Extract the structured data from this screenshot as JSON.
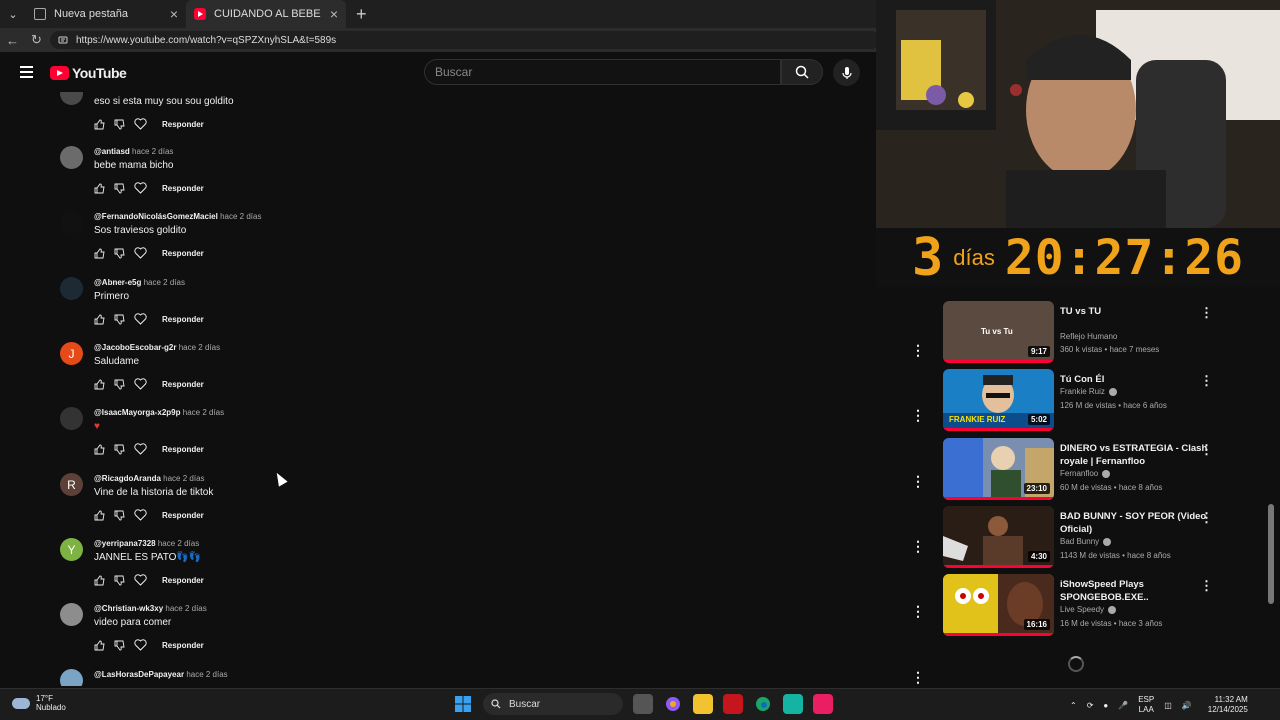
{
  "browser": {
    "tabs": [
      {
        "label": "Nueva pestaña"
      },
      {
        "label": "CUIDANDO AL BEBE DEL DIABLO |"
      }
    ],
    "url": "https://www.youtube.com/watch?v=qSPZXnyhSLA&t=589s"
  },
  "header": {
    "logo_text": "YouTube",
    "search_placeholder": "Buscar"
  },
  "comments": [
    {
      "author": "",
      "time": "",
      "text": "eso si esta muy sou sou goldito",
      "reply": "Responder",
      "avatar_color": "#4a4a4a",
      "avatar_letter": "",
      "show_more": false
    },
    {
      "author": "@antiasd",
      "time": "hace 2 días",
      "text": "bebe mama bicho",
      "reply": "Responder",
      "avatar_color": "#6b6b6b",
      "avatar_letter": "",
      "show_more": false
    },
    {
      "author": "@FernandoNicolásGomezMaciel",
      "time": "hace 2 días",
      "text": "Sos traviesos goldito",
      "reply": "Responder",
      "avatar_color": "#111111",
      "avatar_letter": "",
      "show_more": false
    },
    {
      "author": "@Abner-e5g",
      "time": "hace 2 días",
      "text": "Primero",
      "reply": "Responder",
      "avatar_color": "#1e2a33",
      "avatar_letter": "",
      "show_more": false
    },
    {
      "author": "@JacoboEscobar-g2r",
      "time": "hace 2 días",
      "text": "Saludame",
      "reply": "Responder",
      "avatar_color": "#e64a19",
      "avatar_letter": "J",
      "show_more": true
    },
    {
      "author": "@IsaacMayorga-x2p9p",
      "time": "hace 2 días",
      "text": "♥",
      "reply": "Responder",
      "avatar_color": "#333333",
      "avatar_letter": "",
      "show_more": true
    },
    {
      "author": "@RicagdoAranda",
      "time": "hace 2 días",
      "text": "Vine de la historia de tiktok",
      "reply": "Responder",
      "avatar_color": "#5d4037",
      "avatar_letter": "R",
      "show_more": true
    },
    {
      "author": "@yerripana7328",
      "time": "hace 2 días",
      "text": "JANNEL ES PATO👣👣",
      "reply": "Responder",
      "avatar_color": "#7cb342",
      "avatar_letter": "Y",
      "show_more": true
    },
    {
      "author": "@Christian-wk3xy",
      "time": "hace 2 días",
      "text": "video para comer",
      "reply": "Responder",
      "avatar_color": "#8d8d8d",
      "avatar_letter": "",
      "show_more": true
    },
    {
      "author": "@LasHorasDePapayear",
      "time": "hace 2 días",
      "text": "",
      "reply": "Responder",
      "avatar_color": "#7aa3c4",
      "avatar_letter": "",
      "show_more": true
    }
  ],
  "stream_overlay": {
    "days": "3",
    "days_label": "días",
    "clock": "20:27:26"
  },
  "recommendations": [
    {
      "title": "TU vs TU",
      "channel": "Reflejo Humano",
      "verified": false,
      "meta": "360 k vistas • hace 7 meses",
      "duration": "9:17",
      "thumb_color": "#5a4a3f",
      "thumb_text": "Tu vs Tu",
      "progress": 1.0
    },
    {
      "title": "Tú Con Él",
      "channel": "Frankie Ruiz",
      "verified": true,
      "meta": "126 M de vistas • hace 6 años",
      "duration": "5:02",
      "thumb_color": "#1a7fc4",
      "thumb_text": "FRANKIE RUIZ",
      "progress": 1.0
    },
    {
      "title": "DINERO vs ESTRATEGIA - Clash royale | Fernanfloo",
      "channel": "Fernanfloo",
      "verified": true,
      "meta": "60 M de vistas • hace 8 años",
      "duration": "23:10",
      "thumb_color": "#7a8fb0",
      "thumb_text": "",
      "progress": 1.0
    },
    {
      "title": "BAD BUNNY - SOY PEOR (Video Oficial)",
      "channel": "Bad Bunny",
      "verified": true,
      "meta": "1143 M de vistas • hace 8 años",
      "duration": "4:30",
      "thumb_color": "#3a2a20",
      "thumb_text": "",
      "progress": 1.0
    },
    {
      "title": "iShowSpeed Plays SPONGEBOB.EXE..",
      "channel": "Live Speedy",
      "verified": true,
      "meta": "16 M de vistas • hace 3 años",
      "duration": "16:16",
      "thumb_color": "#c9a31c",
      "thumb_text": "",
      "progress": 1.0
    }
  ],
  "taskbar": {
    "weather_temp": "17°F",
    "weather_desc": "Nublado",
    "search_label": "Buscar",
    "lang_top": "ESP",
    "lang_bottom": "LAA",
    "time": "11:32 AM",
    "date": "12/14/2025"
  }
}
